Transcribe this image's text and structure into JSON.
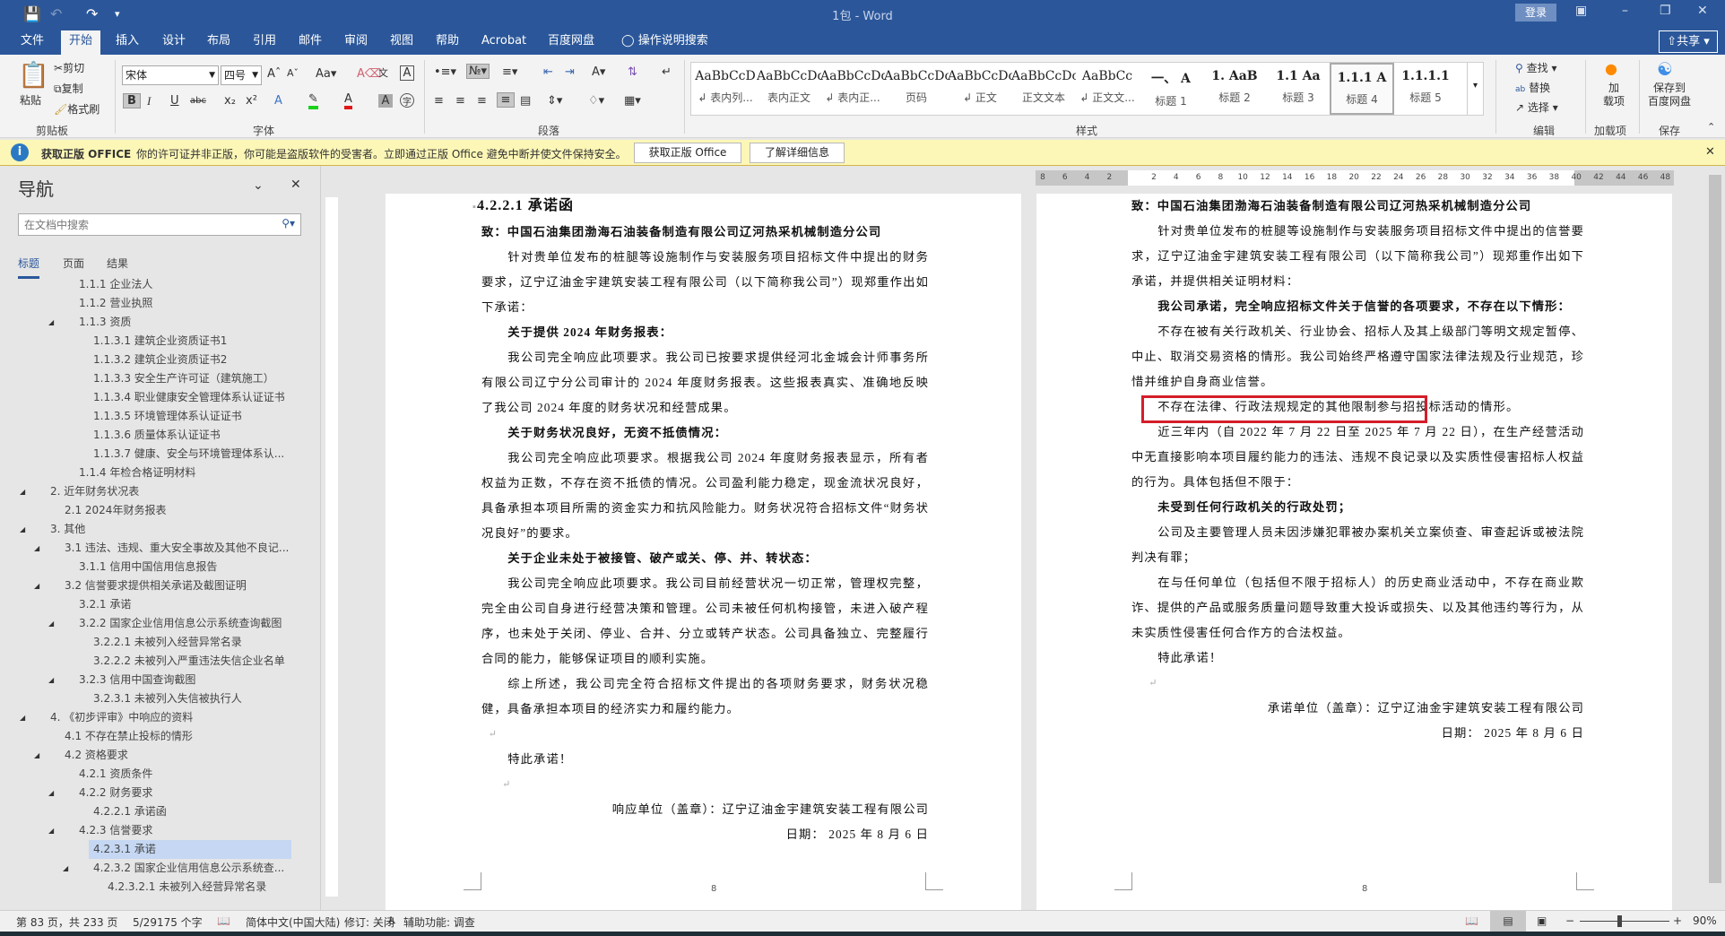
{
  "titlebar": {
    "doc_title": "1包  -  Word",
    "login": "登录",
    "save_icon": "save-icon",
    "undo_icon": "undo-icon",
    "redo_icon": "redo-icon"
  },
  "tabs": [
    "文件",
    "开始",
    "插入",
    "设计",
    "布局",
    "引用",
    "邮件",
    "审阅",
    "视图",
    "帮助",
    "Acrobat",
    "百度网盘"
  ],
  "active_tab": "开始",
  "tell_me": "操作说明搜索",
  "share": "共享",
  "ribbon": {
    "clipboard": {
      "label": "剪贴板",
      "paste": "粘贴",
      "cut": "剪切",
      "copy": "复制",
      "format_painter": "格式刷"
    },
    "font": {
      "label": "字体",
      "font_name": "宋体",
      "font_size": "四号"
    },
    "paragraph": {
      "label": "段落"
    },
    "styles": {
      "label": "样式",
      "items": [
        {
          "preview": "AaBbCcD",
          "name": "↲ 表内列..."
        },
        {
          "preview": "AaBbCcDdI",
          "name": "表内正文"
        },
        {
          "preview": "AaBbCcDdI",
          "name": "↲ 表内正..."
        },
        {
          "preview": "AaBbCcDc",
          "name": "页码"
        },
        {
          "preview": "AaBbCcDc",
          "name": "↲ 正文"
        },
        {
          "preview": "AaBbCcDc",
          "name": "正文文本"
        },
        {
          "preview": "AaBbCc",
          "name": "↲ 正文文..."
        },
        {
          "preview": "一、 A",
          "name": "标题 1"
        },
        {
          "preview": "1. AaB",
          "name": "标题 2"
        },
        {
          "preview": "1.1 Aa",
          "name": "标题 3"
        },
        {
          "preview": "1.1.1 A",
          "name": "标题 4"
        },
        {
          "preview": "1.1.1.1",
          "name": "标题 5"
        }
      ],
      "selected": "标题 4"
    },
    "editing": {
      "label": "编辑",
      "find": "查找",
      "replace": "替换",
      "select": "选择"
    },
    "addins": {
      "label": "加载项",
      "button": "加\n载项"
    },
    "save": {
      "label": "保存",
      "button": "保存到\n百度网盘"
    }
  },
  "message_bar": {
    "title": "获取正版 OFFICE",
    "text": "你的许可证并非正版，你可能是盗版软件的受害者。立即通过正版 Office 避免中断并使文件保持安全。",
    "btn_genuine": "获取正版 Office",
    "btn_more": "了解详细信息"
  },
  "nav": {
    "title": "导航",
    "search_placeholder": "在文档中搜索",
    "tabs": [
      "标题",
      "页面",
      "结果"
    ],
    "items": [
      {
        "text": "1.1.1 企业法人",
        "level": 3,
        "expanded": false
      },
      {
        "text": "1.1.2 营业执照",
        "level": 3,
        "expanded": false
      },
      {
        "text": "1.1.3 资质",
        "level": 3,
        "expanded": true
      },
      {
        "text": "1.1.3.1 建筑企业资质证书1",
        "level": 4,
        "expanded": false
      },
      {
        "text": "1.1.3.2 建筑企业资质证书2",
        "level": 4,
        "expanded": false
      },
      {
        "text": "1.1.3.3 安全生产许可证（建筑施工）",
        "level": 4,
        "expanded": false
      },
      {
        "text": "1.1.3.4 职业健康安全管理体系认证证书",
        "level": 4,
        "expanded": false
      },
      {
        "text": "1.1.3.5 环境管理体系认证证书",
        "level": 4,
        "expanded": false
      },
      {
        "text": "1.1.3.6 质量体系认证证书",
        "level": 4,
        "expanded": false
      },
      {
        "text": "1.1.3.7 健康、安全与环境管理体系认...",
        "level": 4,
        "expanded": false
      },
      {
        "text": "1.1.4 年检合格证明材料",
        "level": 3,
        "expanded": false
      },
      {
        "text": "2. 近年财务状况表",
        "level": 1,
        "expanded": true
      },
      {
        "text": "2.1 2024年财务报表",
        "level": 2,
        "expanded": false
      },
      {
        "text": "3. 其他",
        "level": 1,
        "expanded": true
      },
      {
        "text": "3.1 违法、违规、重大安全事故及其他不良记...",
        "level": 2,
        "expanded": true
      },
      {
        "text": "3.1.1 信用中国信用信息报告",
        "level": 3,
        "expanded": false
      },
      {
        "text": "3.2 信誉要求提供相关承诺及截图证明",
        "level": 2,
        "expanded": true
      },
      {
        "text": "3.2.1 承诺",
        "level": 3,
        "expanded": false
      },
      {
        "text": "3.2.2 国家企业信用信息公示系统查询截图",
        "level": 3,
        "expanded": true
      },
      {
        "text": "3.2.2.1 未被列入经营异常名录",
        "level": 4,
        "expanded": false
      },
      {
        "text": "3.2.2.2 未被列入严重违法失信企业名单",
        "level": 4,
        "expanded": false
      },
      {
        "text": "3.2.3 信用中国查询截图",
        "level": 3,
        "expanded": true
      },
      {
        "text": "3.2.3.1 未被列入失信被执行人",
        "level": 4,
        "expanded": false
      },
      {
        "text": "4. 《初步评审》中响应的资料",
        "level": 1,
        "expanded": true
      },
      {
        "text": "4.1 不存在禁止投标的情形",
        "level": 2,
        "expanded": false
      },
      {
        "text": "4.2 资格要求",
        "level": 2,
        "expanded": true
      },
      {
        "text": "4.2.1 资质条件",
        "level": 3,
        "expanded": false
      },
      {
        "text": "4.2.2 财务要求",
        "level": 3,
        "expanded": true
      },
      {
        "text": "4.2.2.1 承诺函",
        "level": 4,
        "expanded": false
      },
      {
        "text": "4.2.3 信誉要求",
        "level": 3,
        "expanded": true
      },
      {
        "text": "4.2.3.1 承诺",
        "level": 4,
        "expanded": false,
        "selected": true
      },
      {
        "text": "4.2.3.2 国家企业信用信息公示系统查...",
        "level": 4,
        "expanded": true
      },
      {
        "text": "4.2.3.2.1 未被列入经营异常名录",
        "level": 5,
        "expanded": false
      }
    ]
  },
  "ruler_ticks": [
    "8",
    "6",
    "4",
    "2",
    "",
    "2",
    "4",
    "6",
    "8",
    "10",
    "12",
    "14",
    "16",
    "18",
    "20",
    "22",
    "24",
    "26",
    "28",
    "30",
    "32",
    "34",
    "36",
    "38",
    "40",
    "42",
    "44",
    "46",
    "48"
  ],
  "page_left": {
    "heading": "4.2.2.1  承诺函",
    "to": "致：中国石油集团渤海石油装备制造有限公司辽河热采机械制造分公司",
    "intro": "针对贵单位发布的桩腿等设施制作与安装服务项目招标文件中提出的财务要求，辽宁辽油金宇建筑安装工程有限公司（以下简称我公司”）现郑重作出如下承诺：",
    "s1_title": "关于提供 2024 年财务报表：",
    "s1_body": "我公司完全响应此项要求。我公司已按要求提供经河北金城会计师事务所有限公司辽宁分公司审计的 2024 年度财务报表。这些报表真实、准确地反映了我公司 2024 年度的财务状况和经营成果。",
    "s2_title": "关于财务状况良好，无资不抵债情况：",
    "s2_body": "我公司完全响应此项要求。根据我公司 2024 年度财务报表显示，所有者权益为正数，不存在资不抵债的情况。公司盈利能力稳定，现金流状况良好，具备承担本项目所需的资金实力和抗风险能力。财务状况符合招标文件“财务状况良好”的要求。",
    "s3_title": "关于企业未处于被接管、破产或关、停、并、转状态：",
    "s3_body": "我公司完全响应此项要求。我公司目前经营状况一切正常，管理权完整，完全由公司自身进行经营决策和管理。公司未被任何机构接管，未进入破产程序，也未处于关闭、停业、合并、分立或转产状态。公司具备独立、完整履行合同的能力，能够保证项目的顺利实施。",
    "summary": "综上所述，我公司完全符合招标文件提出的各项财务要求，财务状况稳健，具备承担本项目的经济实力和履约能力。",
    "closing": "特此承诺！",
    "signer": "响应单位（盖章）：辽宁辽油金宇建筑安装工程有限公司",
    "date": "日期：  2025  年  8  月  6  日",
    "page_number": "8"
  },
  "page_right": {
    "to": "致：中国石油集团渤海石油装备制造有限公司辽河热采机械制造分公司",
    "intro": "针对贵单位发布的桩腿等设施制作与安装服务项目招标文件中提出的信誉要求，辽宁辽油金宇建筑安装工程有限公司（以下简称我公司”）现郑重作出如下承诺，并提供相关证明材料：",
    "commit_title": "我公司承诺，完全响应招标文件关于信誉的各项要求，不存在以下情形：",
    "p1": "不存在被有关行政机关、行业协会、招标人及其上级部门等明文规定暂停、中止、取消交易资格的情形。我公司始终严格遵守国家法律法规及行业规范，珍惜并维护自身商业信誉。",
    "p2": "不存在法律、行政法规规定的其他限制参与招投标活动的情形。",
    "p3_highlight": "近三年内（自 2022 年 7 月 22 日至 2025 年 7 月 22 日）",
    "p3_rest": "，在生产经营活动中无直接影响本项目履约能力的违法、违规不良记录以及实质性侵害招标人权益的行为。具体包括但不限于：",
    "s_title": "未受到任何行政机关的行政处罚；",
    "p4": "公司及主要管理人员未因涉嫌犯罪被办案机关立案侦查、审查起诉或被法院判决有罪；",
    "p5": "在与任何单位（包括但不限于招标人）的历史商业活动中，不存在商业欺诈、提供的产品或服务质量问题导致重大投诉或损失、以及其他违约等行为，从未实质性侵害任何合作方的合法权益。",
    "closing": "特此承诺！",
    "signer": "承诺单位（盖章）：辽宁辽油金宇建筑安装工程有限公司",
    "date": "日期：  2025  年  8  月  6  日",
    "page_number": "8"
  },
  "highlight_color": "#d51d2a",
  "status": {
    "page": "第 83 页，共 233 页",
    "words": "5/29175 个字",
    "language": "简体中文(中国大陆)",
    "track_changes": "修订: 关闭",
    "accessibility": "辅助功能: 调查",
    "zoom": "90%",
    "zoom_percent": 90
  }
}
